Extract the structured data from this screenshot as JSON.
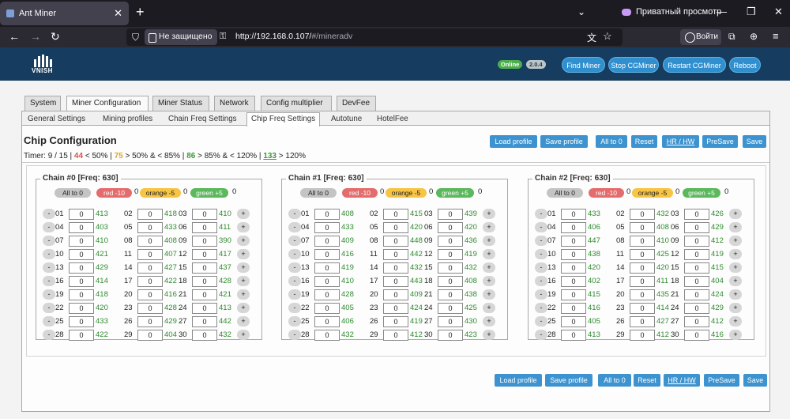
{
  "browser": {
    "tab_title": "Ant Miner",
    "private_label": "Приватный просмотр",
    "not_secure": "Не защищено",
    "url_host": "http://192.168.0.107/",
    "url_path": "#/mineradv",
    "signin_label": "Войти"
  },
  "header": {
    "logo_text": "VNISH",
    "status_badge": "Online",
    "version_badge": "2.0.4",
    "buttons": [
      "Find Miner",
      "Stop CGMiner",
      "Restart CGMiner",
      "Reboot"
    ]
  },
  "tabs": [
    "System",
    "Miner Configuration",
    "Miner Status",
    "Network",
    "Config multiplier",
    "DevFee"
  ],
  "active_tab": "Miner Configuration",
  "subtabs": [
    "General Settings",
    "Mining profiles",
    "Chain Freq Settings",
    "Chip Freq Settings",
    "Autotune",
    "HotelFee"
  ],
  "active_subtab": "Chip Freq Settings",
  "section_title": "Chip Configuration",
  "actions": [
    "Load profile",
    "Save profile",
    "All to 0",
    "Reset",
    "HR / HW",
    "PreSave",
    "Save"
  ],
  "timer": {
    "prefix": "Timer: 9 / 15 |",
    "red_count": "44",
    "red_text": "< 50% |",
    "orange_count": "75",
    "orange_text": "> 50% & < 85% |",
    "green_count": "86",
    "green_text": "> 85% & < 120% |",
    "over_count": "133",
    "over_text": "> 120%"
  },
  "presets": {
    "all": "All to 0",
    "red": "red -10",
    "orange": "orange -5",
    "green": "green +5",
    "zero": "0"
  },
  "colors": {
    "accent": "#3d93cf",
    "header_bg": "#163d5f",
    "green_value": "#2e8b2e"
  },
  "chains": [
    {
      "title": "Chain #0 [Freq: 630]",
      "rows": [
        [
          [
            "01",
            "0",
            "413"
          ],
          [
            "02",
            "0",
            "418"
          ],
          [
            "03",
            "0",
            "410"
          ]
        ],
        [
          [
            "04",
            "0",
            "403"
          ],
          [
            "05",
            "0",
            "433"
          ],
          [
            "06",
            "0",
            "411"
          ]
        ],
        [
          [
            "07",
            "0",
            "410"
          ],
          [
            "08",
            "0",
            "408"
          ],
          [
            "09",
            "0",
            "390"
          ]
        ],
        [
          [
            "10",
            "0",
            "421"
          ],
          [
            "11",
            "0",
            "407"
          ],
          [
            "12",
            "0",
            "417"
          ]
        ],
        [
          [
            "13",
            "0",
            "429"
          ],
          [
            "14",
            "0",
            "427"
          ],
          [
            "15",
            "0",
            "437"
          ]
        ],
        [
          [
            "16",
            "0",
            "414"
          ],
          [
            "17",
            "0",
            "422"
          ],
          [
            "18",
            "0",
            "428"
          ]
        ],
        [
          [
            "19",
            "0",
            "418"
          ],
          [
            "20",
            "0",
            "416"
          ],
          [
            "21",
            "0",
            "421"
          ]
        ],
        [
          [
            "22",
            "0",
            "420"
          ],
          [
            "23",
            "0",
            "428"
          ],
          [
            "24",
            "0",
            "413"
          ]
        ],
        [
          [
            "25",
            "0",
            "433"
          ],
          [
            "26",
            "0",
            "429"
          ],
          [
            "27",
            "0",
            "442"
          ]
        ],
        [
          [
            "28",
            "0",
            "422"
          ],
          [
            "29",
            "0",
            "404"
          ],
          [
            "30",
            "0",
            "432"
          ]
        ]
      ]
    },
    {
      "title": "Chain #1 [Freq: 630]",
      "rows": [
        [
          [
            "01",
            "0",
            "408"
          ],
          [
            "02",
            "0",
            "415"
          ],
          [
            "03",
            "0",
            "439"
          ]
        ],
        [
          [
            "04",
            "0",
            "433"
          ],
          [
            "05",
            "0",
            "420"
          ],
          [
            "06",
            "0",
            "420"
          ]
        ],
        [
          [
            "07",
            "0",
            "409"
          ],
          [
            "08",
            "0",
            "448"
          ],
          [
            "09",
            "0",
            "436"
          ]
        ],
        [
          [
            "10",
            "0",
            "416"
          ],
          [
            "11",
            "0",
            "442"
          ],
          [
            "12",
            "0",
            "419"
          ]
        ],
        [
          [
            "13",
            "0",
            "419"
          ],
          [
            "14",
            "0",
            "432"
          ],
          [
            "15",
            "0",
            "432"
          ]
        ],
        [
          [
            "16",
            "0",
            "410"
          ],
          [
            "17",
            "0",
            "443"
          ],
          [
            "18",
            "0",
            "408"
          ]
        ],
        [
          [
            "19",
            "0",
            "428"
          ],
          [
            "20",
            "0",
            "409"
          ],
          [
            "21",
            "0",
            "438"
          ]
        ],
        [
          [
            "22",
            "0",
            "405"
          ],
          [
            "23",
            "0",
            "424"
          ],
          [
            "24",
            "0",
            "425"
          ]
        ],
        [
          [
            "25",
            "0",
            "406"
          ],
          [
            "26",
            "0",
            "419"
          ],
          [
            "27",
            "0",
            "430"
          ]
        ],
        [
          [
            "28",
            "0",
            "432"
          ],
          [
            "29",
            "0",
            "412"
          ],
          [
            "30",
            "0",
            "423"
          ]
        ]
      ]
    },
    {
      "title": "Chain #2 [Freq: 630]",
      "rows": [
        [
          [
            "01",
            "0",
            "433"
          ],
          [
            "02",
            "0",
            "432"
          ],
          [
            "03",
            "0",
            "426"
          ]
        ],
        [
          [
            "04",
            "0",
            "406"
          ],
          [
            "05",
            "0",
            "408"
          ],
          [
            "06",
            "0",
            "429"
          ]
        ],
        [
          [
            "07",
            "0",
            "447"
          ],
          [
            "08",
            "0",
            "410"
          ],
          [
            "09",
            "0",
            "412"
          ]
        ],
        [
          [
            "10",
            "0",
            "438"
          ],
          [
            "11",
            "0",
            "425"
          ],
          [
            "12",
            "0",
            "419"
          ]
        ],
        [
          [
            "13",
            "0",
            "420"
          ],
          [
            "14",
            "0",
            "420"
          ],
          [
            "15",
            "0",
            "415"
          ]
        ],
        [
          [
            "16",
            "0",
            "402"
          ],
          [
            "17",
            "0",
            "411"
          ],
          [
            "18",
            "0",
            "404"
          ]
        ],
        [
          [
            "19",
            "0",
            "415"
          ],
          [
            "20",
            "0",
            "435"
          ],
          [
            "21",
            "0",
            "424"
          ]
        ],
        [
          [
            "22",
            "0",
            "416"
          ],
          [
            "23",
            "0",
            "414"
          ],
          [
            "24",
            "0",
            "429"
          ]
        ],
        [
          [
            "25",
            "0",
            "405"
          ],
          [
            "26",
            "0",
            "427"
          ],
          [
            "27",
            "0",
            "412"
          ]
        ],
        [
          [
            "28",
            "0",
            "413"
          ],
          [
            "29",
            "0",
            "412"
          ],
          [
            "30",
            "0",
            "416"
          ]
        ]
      ]
    }
  ]
}
